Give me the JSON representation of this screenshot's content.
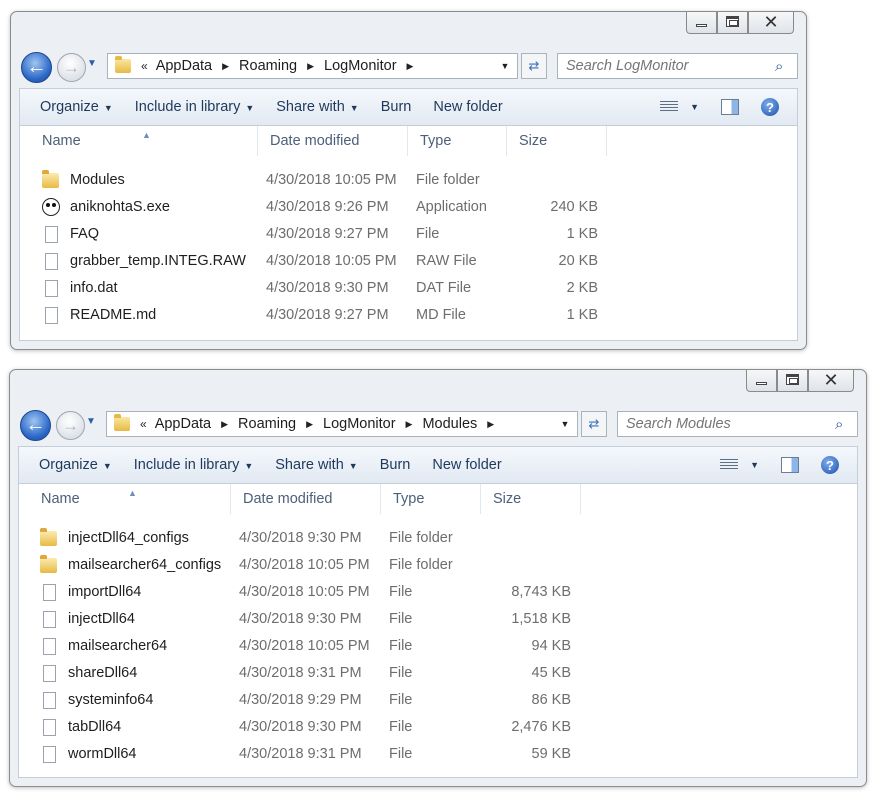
{
  "windows": [
    {
      "caption": {
        "minimize": "",
        "maximize": "",
        "close": "✕"
      },
      "breadcrumbs": [
        "AppData",
        "Roaming",
        "LogMonitor"
      ],
      "search_placeholder": "Search LogMonitor",
      "toolbar": {
        "organize": "Organize",
        "include_in_library": "Include in library",
        "share_with": "Share with",
        "burn": "Burn",
        "new_folder": "New folder"
      },
      "columns": {
        "name": "Name",
        "date": "Date modified",
        "type": "Type",
        "size": "Size"
      },
      "rows": [
        {
          "icon": "folder-icon",
          "name": "Modules",
          "date": "4/30/2018 10:05 PM",
          "type": "File folder",
          "size": ""
        },
        {
          "icon": "app-icon",
          "name": "aniknohtaS.exe",
          "date": "4/30/2018 9:26 PM",
          "type": "Application",
          "size": "240 KB"
        },
        {
          "icon": "file-icon",
          "name": "FAQ",
          "date": "4/30/2018 9:27 PM",
          "type": "File",
          "size": "1 KB"
        },
        {
          "icon": "file-icon",
          "name": "grabber_temp.INTEG.RAW",
          "date": "4/30/2018 10:05 PM",
          "type": "RAW File",
          "size": "20 KB"
        },
        {
          "icon": "file-icon",
          "name": "info.dat",
          "date": "4/30/2018 9:30 PM",
          "type": "DAT File",
          "size": "2 KB"
        },
        {
          "icon": "file-icon",
          "name": "README.md",
          "date": "4/30/2018 9:27 PM",
          "type": "MD File",
          "size": "1 KB"
        }
      ]
    },
    {
      "caption": {
        "minimize": "",
        "maximize": "",
        "close": "✕"
      },
      "breadcrumbs": [
        "AppData",
        "Roaming",
        "LogMonitor",
        "Modules"
      ],
      "search_placeholder": "Search Modules",
      "toolbar": {
        "organize": "Organize",
        "include_in_library": "Include in library",
        "share_with": "Share with",
        "burn": "Burn",
        "new_folder": "New folder"
      },
      "columns": {
        "name": "Name",
        "date": "Date modified",
        "type": "Type",
        "size": "Size"
      },
      "rows": [
        {
          "icon": "folder-icon",
          "name": "injectDll64_configs",
          "date": "4/30/2018 9:30 PM",
          "type": "File folder",
          "size": ""
        },
        {
          "icon": "folder-icon",
          "name": "mailsearcher64_configs",
          "date": "4/30/2018 10:05 PM",
          "type": "File folder",
          "size": ""
        },
        {
          "icon": "file-icon",
          "name": "importDll64",
          "date": "4/30/2018 10:05 PM",
          "type": "File",
          "size": "8,743 KB"
        },
        {
          "icon": "file-icon",
          "name": "injectDll64",
          "date": "4/30/2018 9:30 PM",
          "type": "File",
          "size": "1,518 KB"
        },
        {
          "icon": "file-icon",
          "name": "mailsearcher64",
          "date": "4/30/2018 10:05 PM",
          "type": "File",
          "size": "94 KB"
        },
        {
          "icon": "file-icon",
          "name": "shareDll64",
          "date": "4/30/2018 9:31 PM",
          "type": "File",
          "size": "45 KB"
        },
        {
          "icon": "file-icon",
          "name": "systeminfo64",
          "date": "4/30/2018 9:29 PM",
          "type": "File",
          "size": "86 KB"
        },
        {
          "icon": "file-icon",
          "name": "tabDll64",
          "date": "4/30/2018 9:30 PM",
          "type": "File",
          "size": "2,476 KB"
        },
        {
          "icon": "file-icon",
          "name": "wormDll64",
          "date": "4/30/2018 9:31 PM",
          "type": "File",
          "size": "59 KB"
        }
      ]
    }
  ]
}
